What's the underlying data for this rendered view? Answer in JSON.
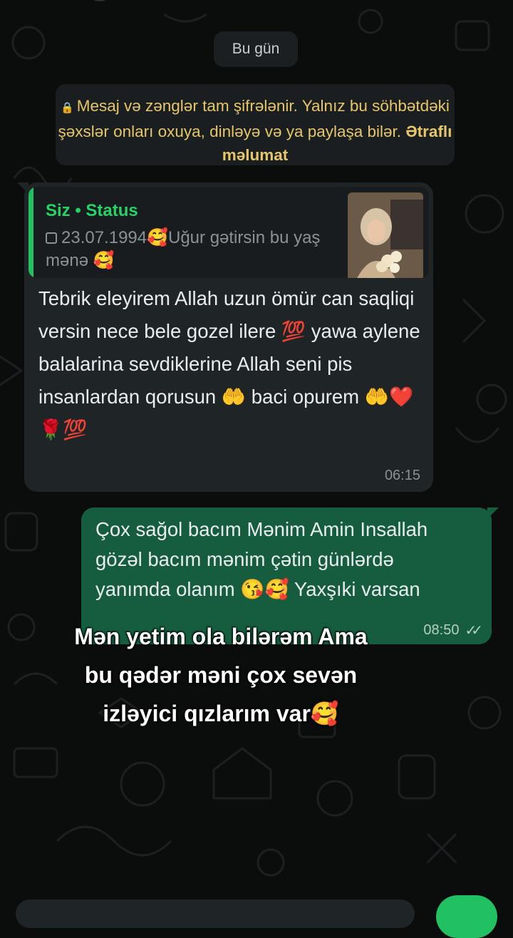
{
  "chat": {
    "date_divider": "Bu gün",
    "encryption_notice": {
      "text": "Mesaj və zənglər tam şifrələnir. Yalnız bu söhbətdəki şəxslər onları oxuya, dinləyə və ya paylaşa bilər.",
      "link": "Ətraflı məlumat"
    },
    "incoming": {
      "quote_author": "Siz • Status",
      "quote_text": "23.07.1994🥰Uğur gətirsin bu yaş mənə 🥰",
      "text": "Tebrik eleyirem Allah uzun ömür can saqliqi versin nece bele gozel ilere 💯 yawa aylene balalarina sevdiklerine Allah seni pis insanlardan qorusun 🤲 baci opurem 🤲❤️🌹💯",
      "time": "06:15"
    },
    "outgoing": {
      "text": "Çox sağol bacım Mənim Amin Insallah gözəl bacım mənim çətin günlərdə yanımda olanım 😘🥰 Yaxşıki varsan",
      "time": "08:50",
      "status_icon": "double-check-icon"
    }
  },
  "overlay_caption": {
    "line1": "Mən yetim ola bilərəm Ama",
    "line2": "bu qədər məni çox sevən",
    "line3": "izləyici qızlarım var🥰"
  },
  "colors": {
    "incoming_bubble": "#1f2426",
    "outgoing_bubble": "#155d3e",
    "accent": "#21c063",
    "notice_text": "#e5c769"
  }
}
